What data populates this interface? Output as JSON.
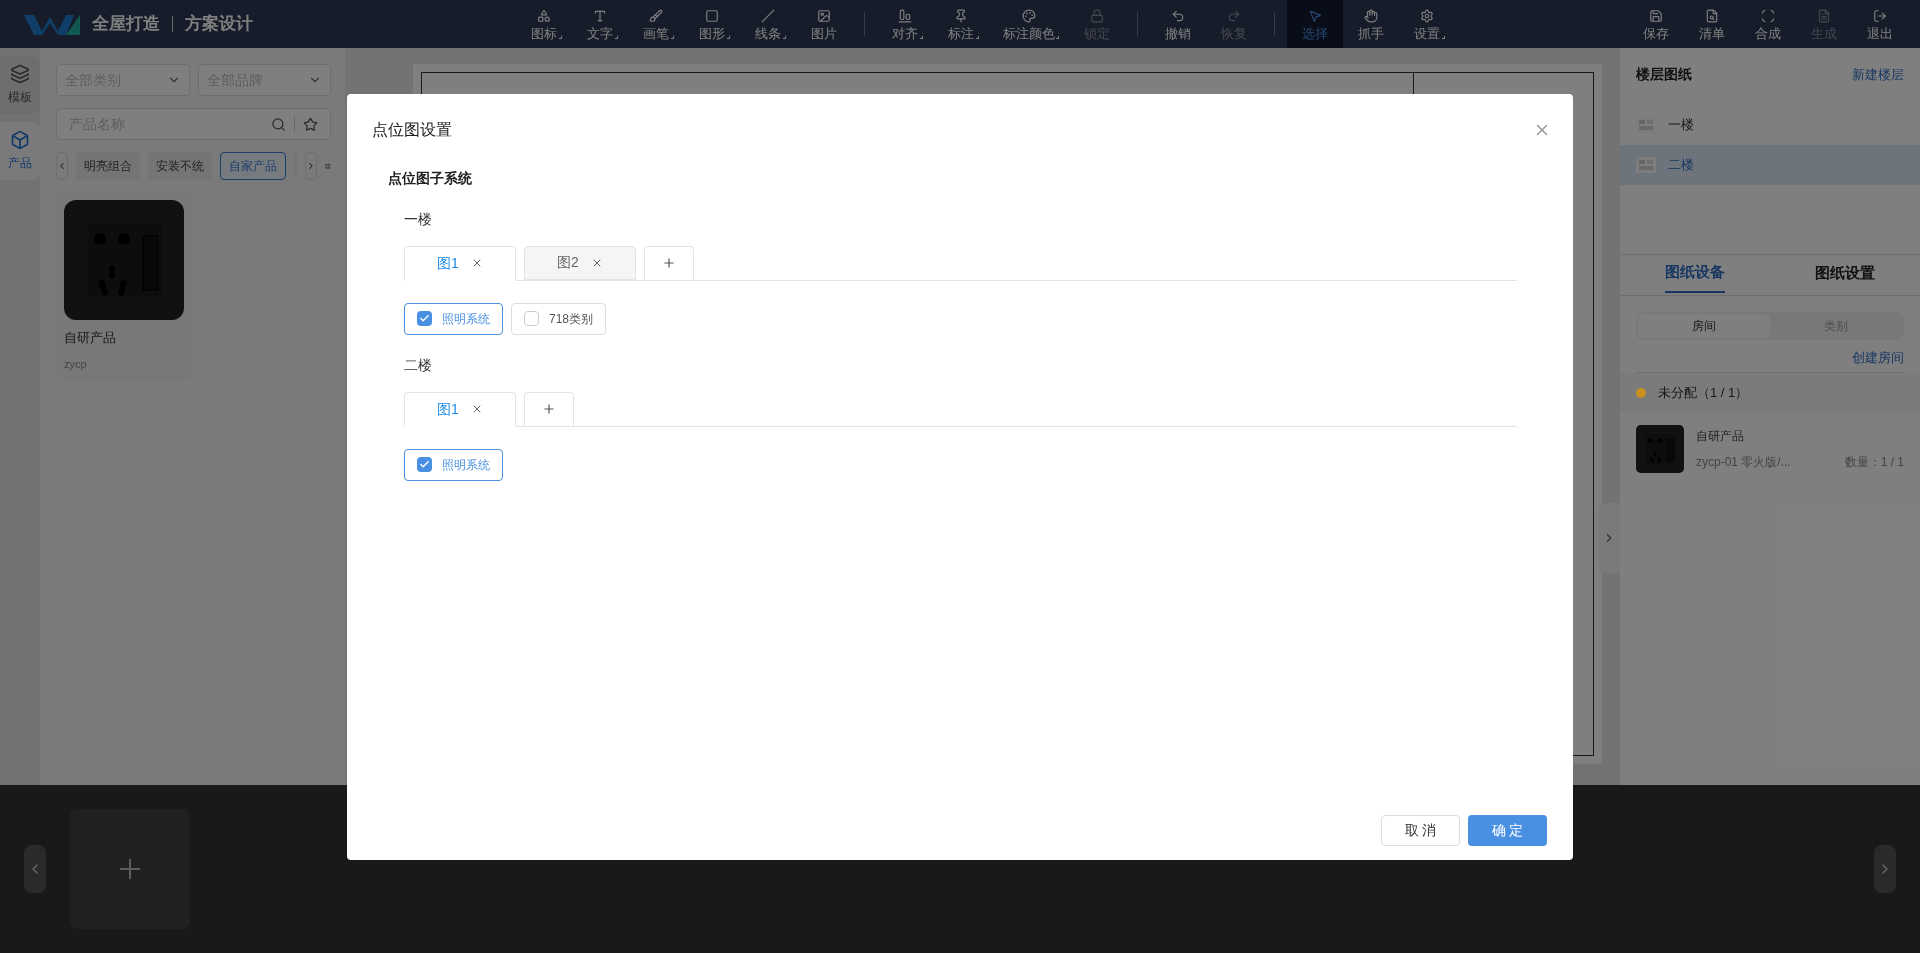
{
  "app": {
    "title": "全屋打造",
    "subtitle": "方案设计"
  },
  "toolbar": [
    {
      "items": [
        {
          "label": "图标",
          "has_menu": true,
          "disabled": false,
          "selected": false
        },
        {
          "label": "文字",
          "has_menu": true,
          "disabled": false,
          "selected": false
        },
        {
          "label": "画笔",
          "has_menu": true,
          "disabled": false,
          "selected": false
        },
        {
          "label": "图形",
          "has_menu": true,
          "disabled": false,
          "selected": false
        },
        {
          "label": "线条",
          "has_menu": true,
          "disabled": false,
          "selected": false
        },
        {
          "label": "图片",
          "has_menu": false,
          "disabled": false,
          "selected": false
        }
      ]
    },
    {
      "items": [
        {
          "label": "对齐",
          "has_menu": true,
          "disabled": false,
          "selected": false
        },
        {
          "label": "标注",
          "has_menu": true,
          "disabled": false,
          "selected": false
        },
        {
          "label": "标注颜色",
          "has_menu": true,
          "disabled": false,
          "selected": false
        },
        {
          "label": "锁定",
          "has_menu": false,
          "disabled": true,
          "selected": false
        }
      ]
    },
    {
      "items": [
        {
          "label": "撤销",
          "has_menu": false,
          "disabled": false,
          "selected": false
        },
        {
          "label": "恢复",
          "has_menu": false,
          "disabled": true,
          "selected": false
        }
      ]
    },
    {
      "items": [
        {
          "label": "选择",
          "has_menu": false,
          "disabled": false,
          "selected": true
        },
        {
          "label": "抓手",
          "has_menu": false,
          "disabled": false,
          "selected": false
        },
        {
          "label": "设置",
          "has_menu": true,
          "disabled": false,
          "selected": false
        }
      ]
    }
  ],
  "actions": [
    {
      "label": "保存",
      "disabled": false
    },
    {
      "label": "清单",
      "disabled": false
    },
    {
      "label": "合成",
      "disabled": false
    },
    {
      "label": "生成",
      "disabled": true
    },
    {
      "label": "退出",
      "disabled": false
    }
  ],
  "rail": [
    {
      "label": "模板",
      "selected": false
    },
    {
      "label": "产品",
      "selected": true
    }
  ],
  "library": {
    "filters": [
      {
        "placeholder": "全部类别"
      },
      {
        "placeholder": "全部品牌"
      }
    ],
    "search": {
      "placeholder": "产品名称"
    },
    "chips": [
      {
        "label": "明亮组合",
        "selected": false
      },
      {
        "label": "安装不统",
        "selected": false
      },
      {
        "label": "自家产品",
        "selected": true
      }
    ],
    "products": [
      {
        "name": "自研产品",
        "code": "zycp"
      }
    ]
  },
  "floors_panel": {
    "title": "楼层图纸",
    "link": "新建楼层",
    "floors": [
      {
        "label": "一楼",
        "selected": false
      },
      {
        "label": "二楼",
        "selected": true
      }
    ],
    "tabs": [
      {
        "label": "图纸设备",
        "selected": true
      },
      {
        "label": "图纸设置",
        "selected": false
      }
    ],
    "segments": [
      {
        "label": "房间",
        "selected": true
      },
      {
        "label": "类别",
        "selected": false
      }
    ],
    "create_link": "创建房间",
    "groups": [
      {
        "label": "未分配（1 / 1）",
        "color": "#c8901e",
        "items": [
          {
            "name": "自研产品",
            "spec": "zycp-01 零火版/...",
            "count": "数量：1 / 1"
          }
        ]
      }
    ]
  },
  "dialog": {
    "title": "点位图设置",
    "section": "点位图子系统",
    "floors": [
      {
        "name": "一楼",
        "tabs": [
          {
            "label": "图1",
            "selected": true
          },
          {
            "label": "图2",
            "selected": false
          }
        ],
        "systems": [
          {
            "label": "照明系统",
            "checked": true
          },
          {
            "label": "718类别",
            "checked": false
          }
        ]
      },
      {
        "name": "二楼",
        "tabs": [
          {
            "label": "图1",
            "selected": true
          }
        ],
        "systems": [
          {
            "label": "照明系统",
            "checked": true
          }
        ]
      }
    ],
    "buttons": [
      {
        "label": "取 消",
        "kind": "secondary"
      },
      {
        "label": "确 定",
        "kind": "primary"
      }
    ]
  }
}
